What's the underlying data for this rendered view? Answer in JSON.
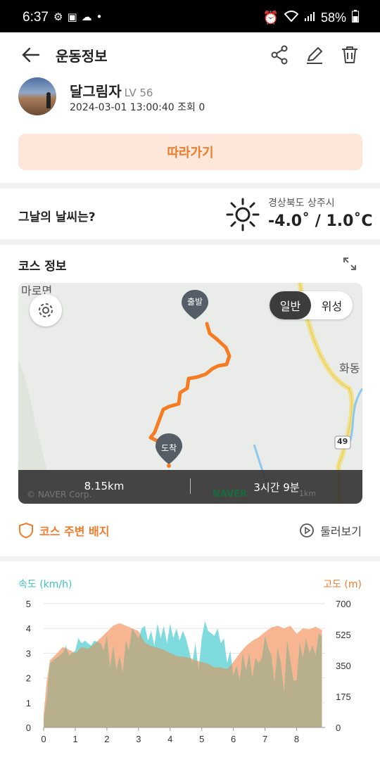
{
  "status": {
    "time": "6:37",
    "battery": "58%"
  },
  "header": {
    "title": "운동정보"
  },
  "user": {
    "name": "달그림자",
    "level": "LV 56",
    "meta": "2024-03-01 13:00:40 조회 0"
  },
  "follow_label": "따라가기",
  "weather": {
    "question": "그날의 날씨는?",
    "location": "경상북도 상주시",
    "temperature": "-4.0˚ / 1.0˚C"
  },
  "course": {
    "title": "코스 정보",
    "map_labels": {
      "place1": "마로면",
      "place2": "화동",
      "road": "49",
      "start": "출발",
      "end": "도착"
    },
    "toggle": {
      "normal": "일반",
      "satellite": "위성"
    },
    "distance": "8.15km",
    "duration": "3시간 9분",
    "copyright": "© NAVER Corp.",
    "brand": "NAVER",
    "scale": "1km"
  },
  "links": {
    "badge": "코스 주변 배지",
    "tour": "둘러보기"
  },
  "chart_data": {
    "type": "area",
    "left_axis_label": "속도 (km/h)",
    "right_axis_label": "고도 (m)",
    "x_ticks": [
      "0",
      "1",
      "2",
      "3",
      "4",
      "5",
      "6",
      "7",
      "8"
    ],
    "left_ticks": [
      "0",
      "1",
      "2",
      "3",
      "4",
      "5"
    ],
    "right_ticks": [
      "0",
      "175",
      "350",
      "525",
      "700"
    ],
    "xlim": [
      0,
      8.9
    ],
    "ylim_left": [
      0,
      5
    ],
    "ylim_right": [
      0,
      700
    ],
    "colors": {
      "speed": "#78d9dc",
      "altitude": "#f7b592",
      "overlap": "#b8b08c",
      "left_axis": "#3cc3c9",
      "right_axis": "#f07c2c"
    },
    "altitude": {
      "x": [
        0,
        0.1,
        0.2,
        0.4,
        0.6,
        0.8,
        1.0,
        1.2,
        1.4,
        1.6,
        1.8,
        2.0,
        2.2,
        2.4,
        2.6,
        2.8,
        3.0,
        3.2,
        3.4,
        3.6,
        3.8,
        4.0,
        4.2,
        4.4,
        4.6,
        4.8,
        5.0,
        5.2,
        5.4,
        5.6,
        5.8,
        6.0,
        6.2,
        6.4,
        6.6,
        6.8,
        7.0,
        7.2,
        7.4,
        7.6,
        7.8,
        8.0,
        8.2,
        8.4,
        8.6,
        8.8
      ],
      "y": [
        75,
        260,
        380,
        415,
        455,
        440,
        420,
        455,
        445,
        470,
        505,
        540,
        575,
        590,
        575,
        560,
        545,
        480,
        460,
        450,
        440,
        420,
        405,
        400,
        395,
        380,
        370,
        360,
        340,
        340,
        330,
        370,
        420,
        460,
        490,
        510,
        540,
        565,
        575,
        560,
        575,
        530,
        560,
        555,
        570,
        550
      ]
    },
    "speed": {
      "x": [
        0,
        0.1,
        0.2,
        0.4,
        0.6,
        0.7,
        0.8,
        1.0,
        1.1,
        1.2,
        1.3,
        1.5,
        1.6,
        1.8,
        1.9,
        2.0,
        2.1,
        2.2,
        2.3,
        2.4,
        2.5,
        2.6,
        2.7,
        2.8,
        2.9,
        3.0,
        3.1,
        3.2,
        3.3,
        3.4,
        3.5,
        3.6,
        3.7,
        3.8,
        3.9,
        4.0,
        4.1,
        4.2,
        4.3,
        4.4,
        4.5,
        4.6,
        4.7,
        4.8,
        4.9,
        5.0,
        5.1,
        5.2,
        5.3,
        5.4,
        5.5,
        5.6,
        5.7,
        5.8,
        5.9,
        6.0,
        6.1,
        6.2,
        6.3,
        6.4,
        6.5,
        6.6,
        6.7,
        6.8,
        6.9,
        7.0,
        7.1,
        7.2,
        7.3,
        7.4,
        7.5,
        7.6,
        7.7,
        7.8,
        7.9,
        8.0,
        8.1,
        8.2,
        8.3,
        8.4,
        8.5,
        8.6,
        8.7,
        8.8
      ],
      "y": [
        0.3,
        1.2,
        2.6,
        2.8,
        3.0,
        3.3,
        2.9,
        3.1,
        3.6,
        3.4,
        3.5,
        3.3,
        3.5,
        3.4,
        3.1,
        3.7,
        2.4,
        3.3,
        2.3,
        2.9,
        2.2,
        3.5,
        3.1,
        4.0,
        3.8,
        3.6,
        4.0,
        4.1,
        3.5,
        3.9,
        3.3,
        4.2,
        3.6,
        4.1,
        3.4,
        4.2,
        3.6,
        4.0,
        3.5,
        3.9,
        3.6,
        3.1,
        2.6,
        3.4,
        2.3,
        3.6,
        4.3,
        3.9,
        3.8,
        3.7,
        4.0,
        3.4,
        3.6,
        2.6,
        3.1,
        2.1,
        2.5,
        1.9,
        3.0,
        2.3,
        3.0,
        2.0,
        2.8,
        2.6,
        2.8,
        3.7,
        3.2,
        2.9,
        1.8,
        3.2,
        2.6,
        1.4,
        3.5,
        2.7,
        1.9,
        1.9,
        3.4,
        2.8,
        3.6,
        3.0,
        3.3,
        2.9,
        3.8,
        3.7
      ]
    }
  }
}
